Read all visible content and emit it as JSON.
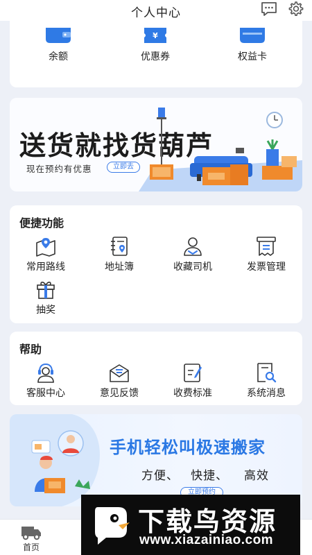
{
  "header": {
    "title": "个人中心",
    "message_icon": "message-icon",
    "settings_icon": "gear-icon"
  },
  "wallet": {
    "items": [
      {
        "label": "余额",
        "icon": "wallet-icon"
      },
      {
        "label": "优惠券",
        "icon": "coupon-icon"
      },
      {
        "label": "权益卡",
        "icon": "card-icon"
      }
    ]
  },
  "banner_top": {
    "headline": "送货就找货葫芦",
    "subtitle": "现在预约有优惠",
    "button": "立即去"
  },
  "quick": {
    "title": "便捷功能",
    "items": [
      {
        "label": "常用路线",
        "icon": "map-route-icon"
      },
      {
        "label": "地址簿",
        "icon": "address-book-icon"
      },
      {
        "label": "收藏司机",
        "icon": "driver-icon"
      },
      {
        "label": "发票管理",
        "icon": "invoice-icon"
      },
      {
        "label": "抽奖",
        "icon": "gift-icon"
      }
    ]
  },
  "help": {
    "title": "帮助",
    "items": [
      {
        "label": "客服中心",
        "icon": "customer-service-icon"
      },
      {
        "label": "意见反馈",
        "icon": "feedback-icon"
      },
      {
        "label": "收费标准",
        "icon": "pricing-icon"
      },
      {
        "label": "系统消息",
        "icon": "system-message-icon"
      }
    ]
  },
  "banner_bottom": {
    "headline": "手机轻松叫极速搬家",
    "subtitle": "方便、   快捷、    高效",
    "button": "立即预约"
  },
  "tabbar": {
    "items": [
      {
        "label": "首页",
        "icon": "truck-icon"
      }
    ]
  },
  "watermark": {
    "title": "下载鸟资源",
    "url": "www.xiazainiao.com"
  },
  "colors": {
    "accent": "#2a78e4",
    "icon_blue": "#3a7be8",
    "background": "#edf0f7"
  }
}
